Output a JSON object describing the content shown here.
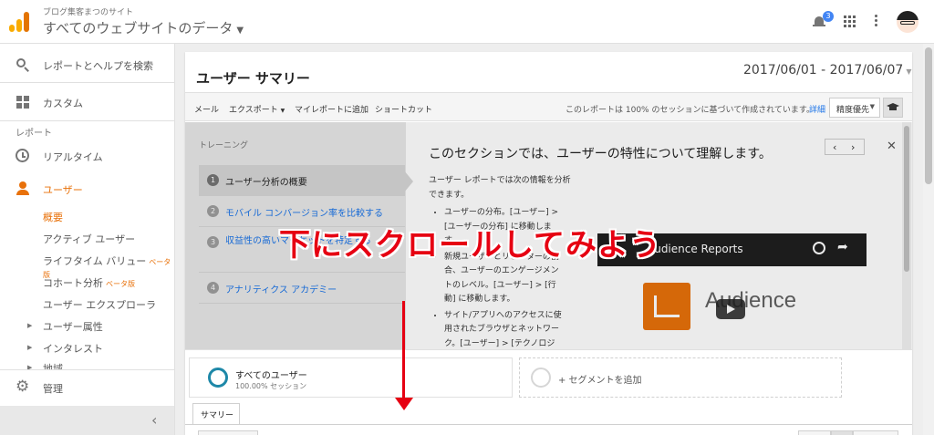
{
  "header": {
    "site_sub": "ブログ集客まつのサイト",
    "site_main": "すべてのウェブサイトのデータ",
    "notification_count": "3"
  },
  "sidebar": {
    "search": "レポートとヘルプを検索",
    "custom": "カスタム",
    "reports_label": "レポート",
    "realtime": "リアルタイム",
    "users": "ユーザー",
    "sub_items": [
      "概要",
      "アクティブ ユーザー",
      "ライフタイム バリュー",
      "コホート分析",
      "ユーザー エクスプローラ",
      "ユーザー属性",
      "インタレスト",
      "地域"
    ],
    "beta": "ベータ版",
    "admin": "管理"
  },
  "report": {
    "title": "ユーザー サマリー",
    "date_range": "2017/06/01 - 2017/06/07"
  },
  "toolbar": {
    "mail": "メール",
    "export": "エクスポート",
    "add_report": "マイレポートに追加",
    "shortcut": "ショートカット",
    "note": "このレポートは 100% のセッションに基づいて作成されています。",
    "detail": "詳細",
    "precision": "精度優先"
  },
  "training": {
    "heading": "トレーニング",
    "steps": [
      {
        "num": "1",
        "label": "ユーザー分析の概要"
      },
      {
        "num": "2",
        "label": "モバイル コンバージョン率を比較する"
      },
      {
        "num": "3",
        "label": "収益性の高いマーケットを特定する"
      },
      {
        "num": "4",
        "label": "アナリティクス アカデミー"
      }
    ],
    "title": "このセクションでは、ユーザーの特性について理解します。",
    "intro": "ユーザー レポートでは次の情報を分析できます。",
    "bullets": [
      "ユーザーの分布。[ユーザー] > [ユーザーの分布] に移動します。",
      "新規ユーザーとリピーターの割合、ユーザーのエンゲージメントのレベル。[ユーザー] > [行動] に移動します。",
      "サイト/アプリへのアクセスに使用されたブラウザとネットワーク。[ユーザー] > [テクノロジー]"
    ],
    "video_title": "Audience Reports",
    "video_brand": "Audience"
  },
  "segments": {
    "all_users": "すべてのユーザー",
    "all_users_sub": "100.00% セッション",
    "add_segment": "+ セグメントを追加"
  },
  "tabs": {
    "summary": "サマリー"
  },
  "annotation": "下にスクロールしてみよう",
  "colors": {
    "accent": "#e8710a",
    "link": "#1a73e8",
    "annotation": "#e60012"
  }
}
